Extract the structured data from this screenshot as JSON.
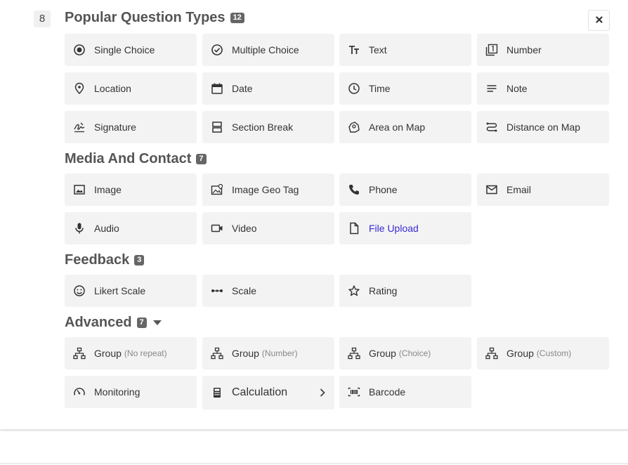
{
  "question_number": "8",
  "sections": {
    "popular": {
      "title": "Popular Question Types",
      "count": "12"
    },
    "media": {
      "title": "Media And Contact",
      "count": "7"
    },
    "feedback": {
      "title": "Feedback",
      "count": "3"
    },
    "advanced": {
      "title": "Advanced",
      "count": "7"
    }
  },
  "items": {
    "single_choice": "Single Choice",
    "multiple_choice": "Multiple Choice",
    "text": "Text",
    "number": "Number",
    "location": "Location",
    "date": "Date",
    "time": "Time",
    "note": "Note",
    "signature": "Signature",
    "section_break": "Section Break",
    "area_on_map": "Area on Map",
    "distance_on_map": "Distance on Map",
    "image": "Image",
    "image_geo_tag": "Image Geo Tag",
    "phone": "Phone",
    "email": "Email",
    "audio": "Audio",
    "video": "Video",
    "file_upload": "File Upload",
    "likert_scale": "Likert Scale",
    "scale": "Scale",
    "rating": "Rating",
    "group_label": "Group",
    "group_no_repeat": "(No repeat)",
    "group_number": "(Number)",
    "group_choice": "(Choice)",
    "group_custom": "(Custom)",
    "monitoring": "Monitoring",
    "calculation": "Calculation",
    "barcode": "Barcode"
  },
  "colors": {
    "link": "#3b2bd3",
    "card_bg": "#f3f3f3",
    "badge_bg": "#666666"
  }
}
